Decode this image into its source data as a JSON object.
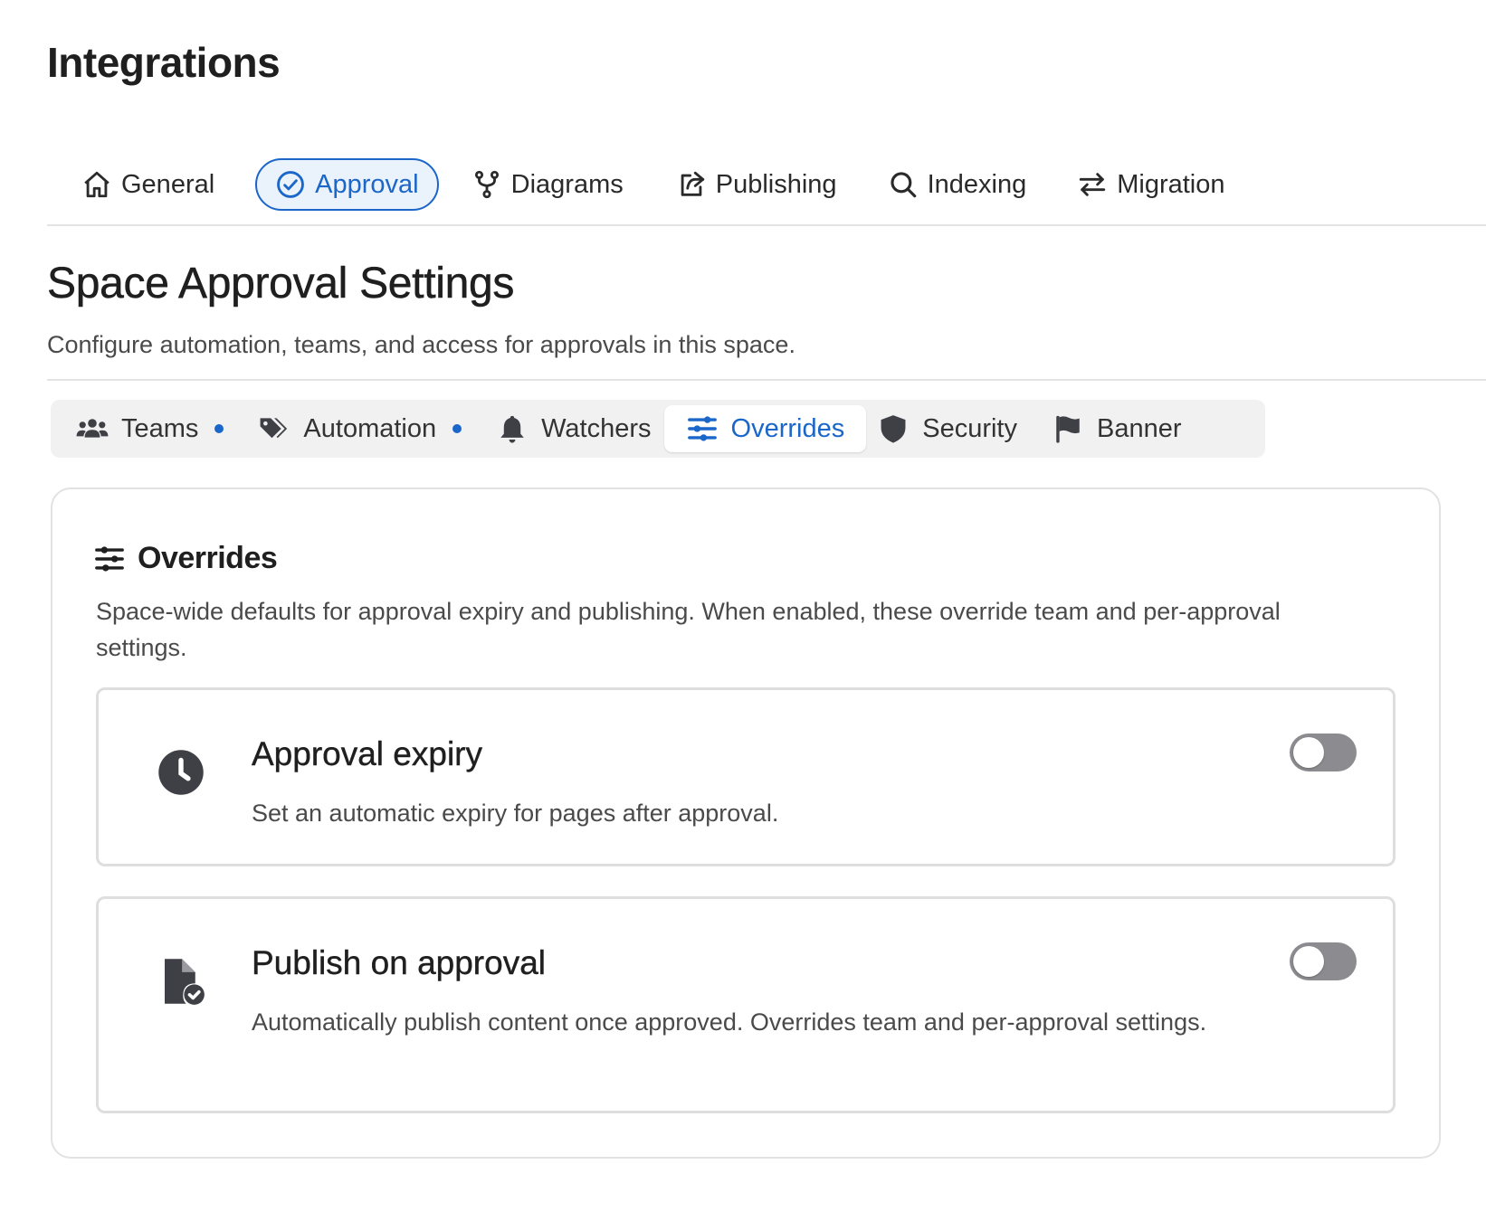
{
  "page": {
    "title": "Integrations"
  },
  "top_tabs": [
    {
      "label": "General",
      "icon": "home-icon",
      "active": false
    },
    {
      "label": "Approval",
      "icon": "check-circle-icon",
      "active": true
    },
    {
      "label": "Diagrams",
      "icon": "branch-icon",
      "active": false
    },
    {
      "label": "Publishing",
      "icon": "share-icon",
      "active": false
    },
    {
      "label": "Indexing",
      "icon": "search-icon",
      "active": false
    },
    {
      "label": "Migration",
      "icon": "swap-arrows-icon",
      "active": false
    }
  ],
  "section": {
    "title": "Space Approval Settings",
    "subtitle": "Configure automation, teams, and access for approvals in this space."
  },
  "sub_tabs": [
    {
      "label": "Teams",
      "icon": "users-icon",
      "active": false,
      "has_dot": true
    },
    {
      "label": "Automation",
      "icon": "tags-icon",
      "active": false,
      "has_dot": true
    },
    {
      "label": "Watchers",
      "icon": "bell-icon",
      "active": false,
      "has_dot": false
    },
    {
      "label": "Overrides",
      "icon": "sliders-icon",
      "active": true,
      "has_dot": false
    },
    {
      "label": "Security",
      "icon": "shield-icon",
      "active": false,
      "has_dot": false
    },
    {
      "label": "Banner",
      "icon": "flag-icon",
      "active": false,
      "has_dot": false
    }
  ],
  "overrides": {
    "title": "Overrides",
    "description": "Space-wide defaults for approval expiry and publishing. When enabled, these override team and per-approval settings.",
    "settings": [
      {
        "title": "Approval expiry",
        "description": "Set an automatic expiry for pages after approval.",
        "icon": "clock-icon",
        "enabled": false
      },
      {
        "title": "Publish on approval",
        "description": "Automatically publish content once approved. Overrides team and per-approval settings.",
        "icon": "file-check-icon",
        "enabled": false
      }
    ]
  },
  "colors": {
    "accent": "#1a66c9",
    "accent_bg": "#eaf2fc",
    "toggle_off": "#8c8c90",
    "icon_dark": "#3f3f46"
  }
}
